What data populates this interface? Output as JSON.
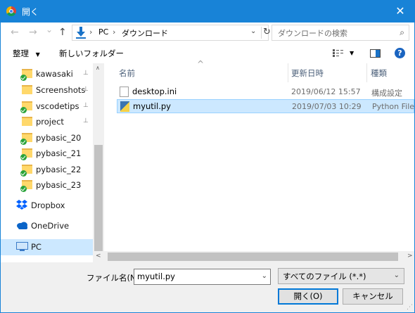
{
  "window": {
    "title": "開く",
    "close_glyph": "✕"
  },
  "nav": {
    "back_glyph": "←",
    "forward_glyph": "→",
    "recent_glyph": "⌄",
    "up_glyph": "↑",
    "crumbs": [
      "PC",
      "ダウンロード"
    ],
    "crumb_sep": "›",
    "dropdown_glyph": "⌄",
    "refresh_glyph": "↻",
    "search_placeholder": "ダウンロードの検索",
    "search_icon": "⌕"
  },
  "toolbar": {
    "organize_label": "整理",
    "organize_arrow": "▼",
    "new_folder_label": "新しいフォルダー",
    "view_arrow": "▼",
    "help_glyph": "?"
  },
  "sidebar": {
    "items": [
      {
        "label": "kawasaki",
        "pinned": true,
        "synced": true,
        "icon": "folder-icon"
      },
      {
        "label": "Screenshots",
        "pinned": true,
        "synced": false,
        "icon": "folder-icon"
      },
      {
        "label": "vscodetips",
        "pinned": true,
        "synced": true,
        "icon": "folder-icon"
      },
      {
        "label": "project",
        "pinned": true,
        "synced": false,
        "icon": "folder-icon"
      },
      {
        "label": "pybasic_20",
        "pinned": false,
        "synced": true,
        "icon": "folder-icon"
      },
      {
        "label": "pybasic_21",
        "pinned": false,
        "synced": true,
        "icon": "folder-icon"
      },
      {
        "label": "pybasic_22",
        "pinned": false,
        "synced": true,
        "icon": "folder-icon"
      },
      {
        "label": "pybasic_23",
        "pinned": false,
        "synced": true,
        "icon": "folder-icon"
      },
      {
        "label": "Dropbox",
        "icon": "dropbox-icon"
      },
      {
        "label": "OneDrive",
        "icon": "onedrive-icon"
      },
      {
        "label": "PC",
        "icon": "pc-icon",
        "selected": true
      }
    ],
    "pin_glyph": "📌"
  },
  "columns": {
    "name": "名前",
    "modified": "更新日時",
    "type": "種類"
  },
  "files": [
    {
      "name": "desktop.ini",
      "modified": "2019/06/12 15:57",
      "type": "構成設定",
      "icon": "file-ini-icon",
      "selected": false
    },
    {
      "name": "myutil.py",
      "modified": "2019/07/03 10:29",
      "type": "Python File",
      "icon": "python-file-icon",
      "selected": true
    }
  ],
  "bottom": {
    "filename_label": "ファイル名(N):",
    "filename_value": "myutil.py",
    "filetype_value": "すべてのファイル (*.*)",
    "dropdown_glyph": "⌄",
    "open_label": "開く(O)",
    "cancel_label": "キャンセル"
  },
  "scroll": {
    "up": "∧",
    "down": "∨",
    "left": "<",
    "right": ">"
  },
  "colors": {
    "titlebar": "#1883d7",
    "selection": "#cce8ff",
    "accent": "#0078d7"
  }
}
